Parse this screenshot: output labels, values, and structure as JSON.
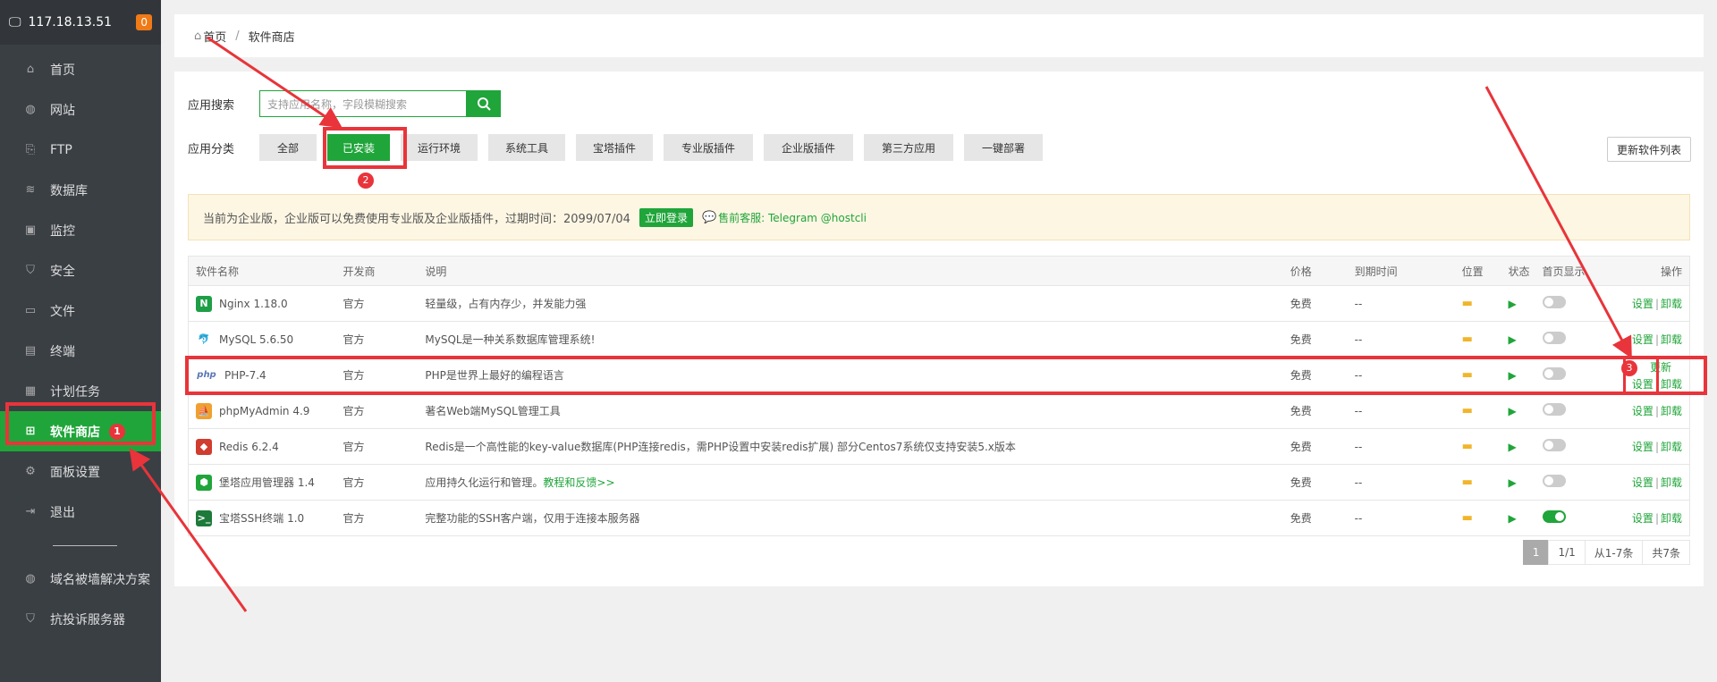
{
  "sidebar": {
    "ip": "117.18.13.51",
    "badge": "0",
    "items": [
      {
        "label": "首页",
        "icon": "home-icon"
      },
      {
        "label": "网站",
        "icon": "globe-icon"
      },
      {
        "label": "FTP",
        "icon": "ftp-icon"
      },
      {
        "label": "数据库",
        "icon": "database-icon"
      },
      {
        "label": "监控",
        "icon": "monitor-icon"
      },
      {
        "label": "安全",
        "icon": "shield-icon"
      },
      {
        "label": "文件",
        "icon": "folder-icon"
      },
      {
        "label": "终端",
        "icon": "terminal-icon"
      },
      {
        "label": "计划任务",
        "icon": "clock-icon"
      },
      {
        "label": "软件商店",
        "icon": "grid-icon"
      },
      {
        "label": "面板设置",
        "icon": "gear-icon"
      },
      {
        "label": "退出",
        "icon": "logout-icon"
      }
    ],
    "extra_items": [
      {
        "label": "域名被墙解决方案",
        "icon": "globe-icon"
      },
      {
        "label": "抗投诉服务器",
        "icon": "shield-icon"
      }
    ],
    "active_badge": "1"
  },
  "breadcrumb": {
    "home": "首页",
    "sep": "/",
    "current": "软件商店"
  },
  "search": {
    "label": "应用搜索",
    "placeholder": "支持应用名称，字段模糊搜索"
  },
  "categories": {
    "label": "应用分类",
    "items": [
      "全部",
      "已安装",
      "运行环境",
      "系统工具",
      "宝塔插件",
      "专业版插件",
      "企业版插件",
      "第三方应用",
      "一键部署"
    ],
    "active_badge": "2"
  },
  "refresh_label": "更新软件列表",
  "notice": {
    "text": "当前为企业版，企业版可以免费使用专业版及企业版插件，过期时间：2099/07/04",
    "login": "立即登录",
    "support": "售前客服: Telegram @hostcli"
  },
  "table": {
    "headers": [
      "软件名称",
      "开发商",
      "说明",
      "价格",
      "到期时间",
      "位置",
      "状态",
      "首页显示",
      "操作"
    ],
    "rows": [
      {
        "name": "Nginx 1.18.0",
        "dev": "官方",
        "desc": "轻量级，占有内存少，并发能力强",
        "price": "免费",
        "expire": "--",
        "show": false,
        "ops": [
          "设置",
          "卸载"
        ]
      },
      {
        "name": "MySQL 5.6.50",
        "dev": "官方",
        "desc": "MySQL是一种关系数据库管理系统!",
        "price": "免费",
        "expire": "--",
        "show": false,
        "ops": [
          "设置",
          "卸载"
        ]
      },
      {
        "name": "PHP-7.4",
        "dev": "官方",
        "desc": "PHP是世界上最好的编程语言",
        "price": "免费",
        "expire": "--",
        "show": false,
        "ops": [
          "更新",
          "设置",
          "卸载"
        ],
        "badge": "3"
      },
      {
        "name": "phpMyAdmin 4.9",
        "dev": "官方",
        "desc": "著名Web端MySQL管理工具",
        "price": "免费",
        "expire": "--",
        "show": false,
        "ops": [
          "设置",
          "卸载"
        ]
      },
      {
        "name": "Redis 6.2.4",
        "dev": "官方",
        "desc": "Redis是一个高性能的key-value数据库(PHP连接redis，需PHP设置中安装redis扩展) 部分Centos7系统仅支持安装5.x版本",
        "price": "免费",
        "expire": "--",
        "show": false,
        "ops": [
          "设置",
          "卸载"
        ]
      },
      {
        "name": "堡塔应用管理器 1.4",
        "dev": "官方",
        "desc": "应用持久化运行和管理。",
        "desc_link": "教程和反馈>>",
        "price": "免费",
        "expire": "--",
        "show": false,
        "ops": [
          "设置",
          "卸载"
        ]
      },
      {
        "name": "宝塔SSH终端 1.0",
        "dev": "官方",
        "desc": "完整功能的SSH客户端，仅用于连接本服务器",
        "price": "免费",
        "expire": "--",
        "show": true,
        "ops": [
          "设置",
          "卸载"
        ]
      }
    ]
  },
  "pager": {
    "current": "1",
    "pages": "1/1",
    "range": "从1-7条",
    "total": "共7条"
  }
}
